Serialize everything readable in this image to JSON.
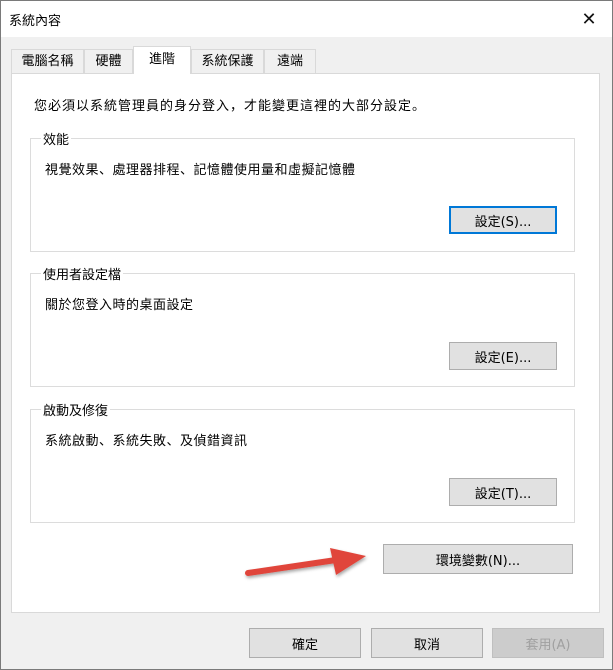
{
  "window": {
    "title": "系統內容",
    "close_glyph": "✕"
  },
  "tabs": [
    {
      "label": "電腦名稱",
      "active": false
    },
    {
      "label": "硬體",
      "active": false
    },
    {
      "label": "進階",
      "active": true
    },
    {
      "label": "系統保護",
      "active": false
    },
    {
      "label": "遠端",
      "active": false
    }
  ],
  "advanced": {
    "admin_notice": "您必須以系統管理員的身分登入，才能變更這裡的大部分設定。",
    "performance": {
      "legend": "效能",
      "description": "視覺效果、處理器排程、記憶體使用量和虛擬記憶體",
      "button": "設定(S)..."
    },
    "user_profiles": {
      "legend": "使用者設定檔",
      "description": "關於您登入時的桌面設定",
      "button": "設定(E)..."
    },
    "startup_recovery": {
      "legend": "啟動及修復",
      "description": "系統啟動、系統失敗、及偵錯資訊",
      "button": "設定(T)..."
    },
    "env_button": "環境變數(N)..."
  },
  "footer": {
    "ok": "確定",
    "cancel": "取消",
    "apply": "套用(A)"
  },
  "colors": {
    "arrow": "#e0453a",
    "focus": "#0078d7"
  }
}
